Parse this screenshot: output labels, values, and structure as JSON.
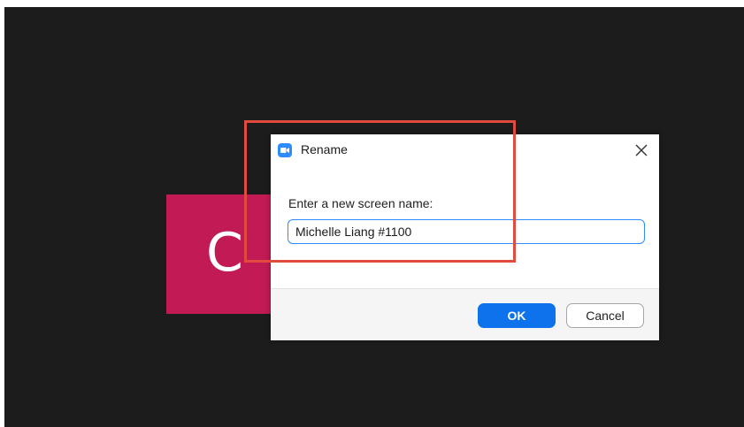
{
  "avatar": {
    "initial": "C",
    "color": "#c21a54"
  },
  "dialog": {
    "title": "Rename",
    "app_icon": "zoom-camera-icon",
    "close_icon": "close-icon",
    "prompt": "Enter a new screen name:",
    "name_value": "Michelle Liang #1100",
    "ok_label": "OK",
    "cancel_label": "Cancel"
  },
  "colors": {
    "meeting_background": "#1c1c1c",
    "accent": "#2d8cff",
    "ok_button": "#0e72ed",
    "highlight": "#e04a3f"
  }
}
